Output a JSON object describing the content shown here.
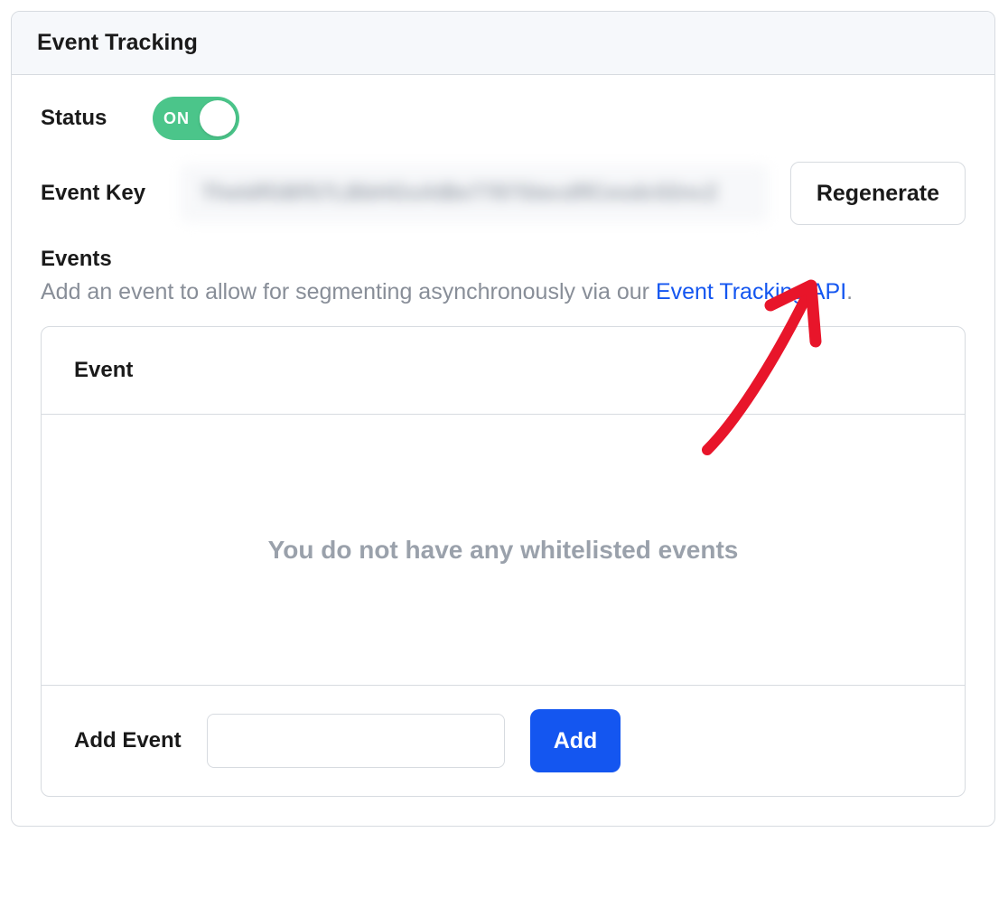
{
  "panel": {
    "title": "Event Tracking",
    "status": {
      "label": "Status",
      "toggle_text": "ON",
      "enabled": true
    },
    "event_key": {
      "label": "Event Key",
      "value_masked": "TheIdfGBfS7LBbHGsAtBe7787StecdflCesdc02ncZ",
      "regenerate_label": "Regenerate"
    },
    "events": {
      "heading": "Events",
      "description_prefix": "Add an event to allow for segmenting asynchronously via our ",
      "link_text": "Event Tracking API",
      "description_suffix": ".",
      "table_header": "Event",
      "empty_message": "You do not have any whitelisted events",
      "add_label": "Add Event",
      "add_button": "Add"
    }
  }
}
